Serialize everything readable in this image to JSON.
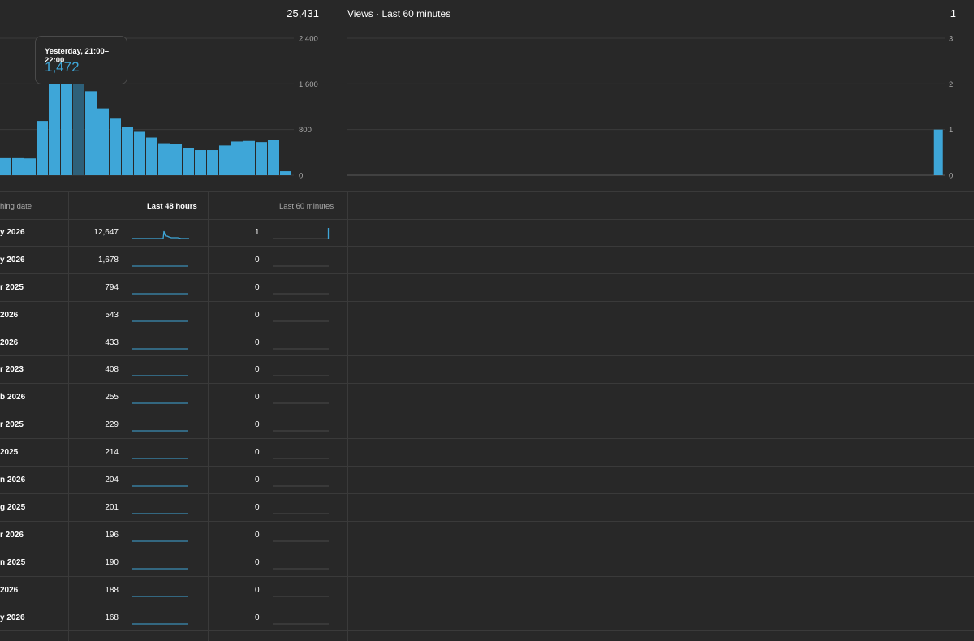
{
  "left_chart": {
    "total": "25,431",
    "y_ticks": [
      "2,400",
      "1,600",
      "800",
      "0"
    ],
    "tooltip": {
      "label": "Yesterday, 21:00–22:00",
      "value": "1,472"
    },
    "highlight_index": 6
  },
  "right_chart": {
    "title": "Views · Last 60 minutes",
    "total": "1",
    "y_ticks": [
      "3",
      "2",
      "1",
      "0"
    ]
  },
  "chart_data": [
    {
      "type": "bar",
      "ylim": [
        0,
        2400
      ],
      "values": [
        300,
        300,
        295,
        950,
        1600,
        1600,
        1600,
        1472,
        1170,
        990,
        840,
        760,
        660,
        560,
        540,
        480,
        440,
        440,
        520,
        590,
        600,
        580,
        620,
        70,
        0
      ]
    },
    {
      "type": "bar",
      "title": "Views · Last 60 minutes",
      "ylim": [
        0,
        3
      ],
      "values": [
        0,
        0,
        0,
        0,
        0,
        0,
        0,
        0,
        0,
        0,
        0,
        0,
        0,
        0,
        0,
        0,
        0,
        0,
        0,
        0,
        0,
        0,
        0,
        0,
        0,
        0,
        0,
        0,
        0,
        0,
        0,
        0,
        0,
        0,
        0,
        0,
        0,
        0,
        0,
        0,
        0,
        0,
        0,
        0,
        0,
        0,
        0,
        0,
        0,
        0,
        0,
        0,
        0,
        0,
        0,
        0,
        0,
        0,
        0,
        1
      ]
    }
  ],
  "table": {
    "headers": {
      "name": "hing date",
      "last48": "Last 48 hours",
      "last60": "Last 60 minutes"
    },
    "rows": [
      {
        "name": "y 2026",
        "v48": "12,647",
        "v60": "1"
      },
      {
        "name": "y 2026",
        "v48": "1,678",
        "v60": "0"
      },
      {
        "name": "r 2025",
        "v48": "794",
        "v60": "0"
      },
      {
        "name": " 2026",
        "v48": "543",
        "v60": "0"
      },
      {
        "name": "2026",
        "v48": "433",
        "v60": "0"
      },
      {
        "name": "r 2023",
        "v48": "408",
        "v60": "0"
      },
      {
        "name": "b 2026",
        "v48": "255",
        "v60": "0"
      },
      {
        "name": "r 2025",
        "v48": "229",
        "v60": "0"
      },
      {
        "name": " 2025",
        "v48": "214",
        "v60": "0"
      },
      {
        "name": "n 2026",
        "v48": "204",
        "v60": "0"
      },
      {
        "name": "g 2025",
        "v48": "201",
        "v60": "0"
      },
      {
        "name": "r 2026",
        "v48": "196",
        "v60": "0"
      },
      {
        "name": "n 2025",
        "v48": "190",
        "v60": "0"
      },
      {
        "name": "2026",
        "v48": "188",
        "v60": "0"
      },
      {
        "name": "y 2026",
        "v48": "168",
        "v60": "0"
      }
    ]
  },
  "colors": {
    "accent": "#3ea6d8",
    "highlight": "#2e6079",
    "background": "#282828"
  }
}
